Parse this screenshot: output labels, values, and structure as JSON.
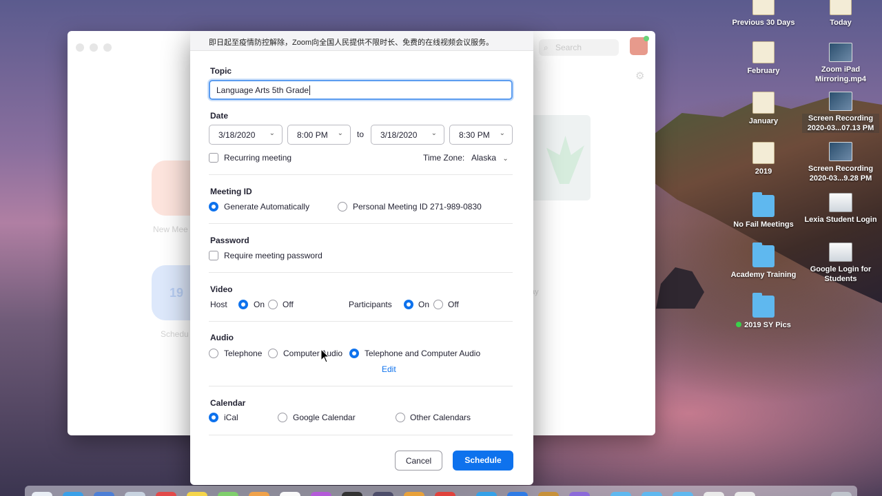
{
  "desktop": {
    "icons": [
      {
        "id": "prev30",
        "label": "Previous 30 Days",
        "kind": "doc"
      },
      {
        "id": "today",
        "label": "Today",
        "kind": "doc"
      },
      {
        "id": "february",
        "label": "February",
        "kind": "doc"
      },
      {
        "id": "zoom-ipad",
        "label": "Zoom iPad Mirroring.mp4",
        "kind": "video"
      },
      {
        "id": "january",
        "label": "January",
        "kind": "doc"
      },
      {
        "id": "screenrec1",
        "label": "Screen Recording 2020-03...07.13 PM",
        "kind": "video"
      },
      {
        "id": "y2019",
        "label": "2019",
        "kind": "doc"
      },
      {
        "id": "screenrec2",
        "label": "Screen Recording 2020-03...9.28 PM",
        "kind": "video"
      },
      {
        "id": "nofail",
        "label": "No Fail Meetings",
        "kind": "folder"
      },
      {
        "id": "lexia",
        "label": "Lexia Student Login",
        "kind": "shot"
      },
      {
        "id": "academy",
        "label": "Academy Training",
        "kind": "folder"
      },
      {
        "id": "google-login",
        "label": "Google Login for Students",
        "kind": "shot"
      },
      {
        "id": "sypics",
        "label": "2019 SY Pics",
        "kind": "folder"
      }
    ]
  },
  "zoom_main": {
    "search_placeholder": "Search",
    "new_meeting_label": "New Mee",
    "schedule_label": "Schedu",
    "calendar_day": "19",
    "side_text": "ay"
  },
  "dialog": {
    "notice": "即日起至疫情防控解除，Zoom向全国人民提供不限时长、免费的在线视频会议服务。",
    "topic": {
      "title": "Topic",
      "value": "Language Arts 5th Grade"
    },
    "date": {
      "title": "Date",
      "start_date": "3/18/2020",
      "start_time": "8:00 PM",
      "to": "to",
      "end_date": "3/18/2020",
      "end_time": "8:30 PM",
      "recurring_label": "Recurring meeting",
      "recurring_checked": false,
      "timezone_label": "Time Zone:",
      "timezone_value": "Alaska"
    },
    "meeting_id": {
      "title": "Meeting ID",
      "options": [
        "Generate Automatically",
        "Personal Meeting ID 271-989-0830"
      ],
      "selected": 0
    },
    "password": {
      "title": "Password",
      "require_label": "Require meeting password",
      "checked": false
    },
    "video": {
      "title": "Video",
      "host_label": "Host",
      "participants_label": "Participants",
      "on_label": "On",
      "off_label": "Off",
      "host_value": "On",
      "participants_value": "On"
    },
    "audio": {
      "title": "Audio",
      "options": [
        "Telephone",
        "Computer Audio",
        "Telephone and Computer Audio"
      ],
      "selected": 2,
      "edit_label": "Edit"
    },
    "calendar": {
      "title": "Calendar",
      "options": [
        "iCal",
        "Google Calendar",
        "Other Calendars"
      ],
      "selected": 0
    },
    "buttons": {
      "cancel": "Cancel",
      "schedule": "Schedule"
    }
  },
  "colors": {
    "accent": "#0e72ed",
    "focus_ring": "#5b9cf0",
    "text": "#232333"
  }
}
